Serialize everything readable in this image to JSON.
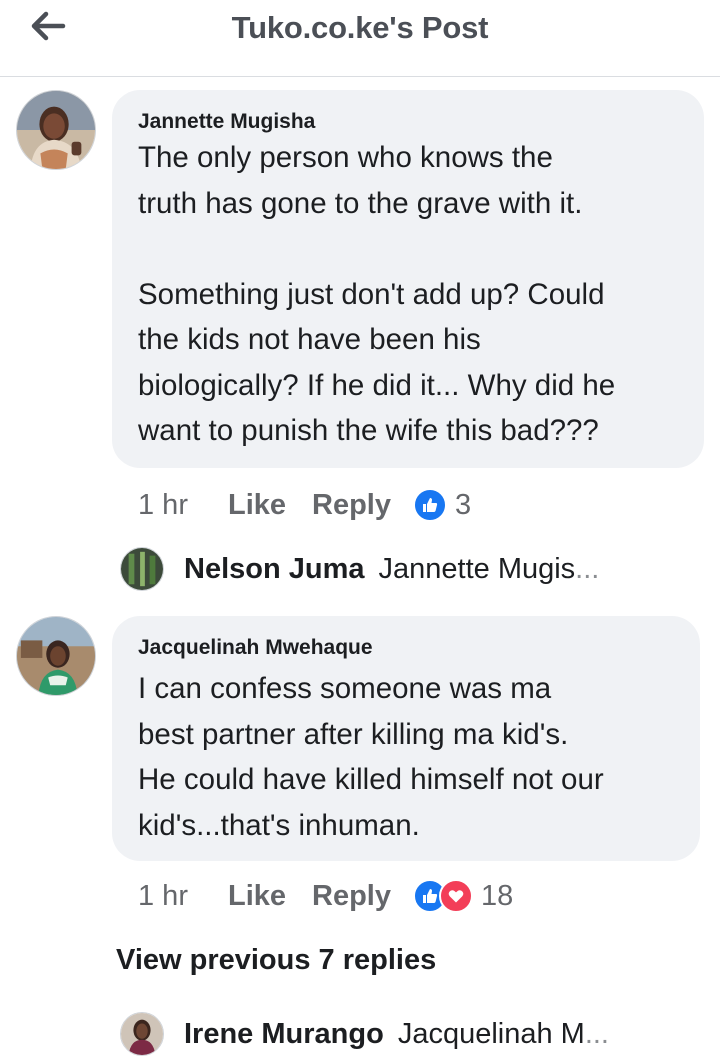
{
  "header": {
    "title": "Tuko.co.ke's Post",
    "back_icon": "arrow-left-icon"
  },
  "comments": [
    {
      "author": "Jannette Mugisha",
      "text": "The only person who knows the\ntruth has gone to the grave with it.\n\nSomething just don't add up? Could\nthe kids not have been his\nbiologically? If he did it... Why did he\nwant to punish the wife this bad???",
      "time": "1 hr",
      "like_label": "Like",
      "reply_label": "Reply",
      "reactions": [
        "like"
      ],
      "reaction_count": "3",
      "reply_preview": {
        "name": "Nelson Juma",
        "snippet": "Jannette Mugis",
        "ellipsis": "..."
      }
    },
    {
      "author": "Jacquelinah Mwehaque",
      "text": "I can confess someone was ma\nbest partner after killing ma kid's.\nHe could have killed himself not our\nkid's...that's inhuman.",
      "time": "1 hr",
      "like_label": "Like",
      "reply_label": "Reply",
      "reactions": [
        "like",
        "love"
      ],
      "reaction_count": "18",
      "view_previous": "View previous 7 replies",
      "reply_preview": {
        "name": "Irene Murango",
        "snippet": "Jacquelinah M",
        "ellipsis": "..."
      }
    }
  ],
  "colors": {
    "bubble": "#f0f2f5",
    "like": "#1877f2",
    "love": "#f33e58",
    "muted": "#65676b",
    "header_text": "#4b4f56"
  }
}
